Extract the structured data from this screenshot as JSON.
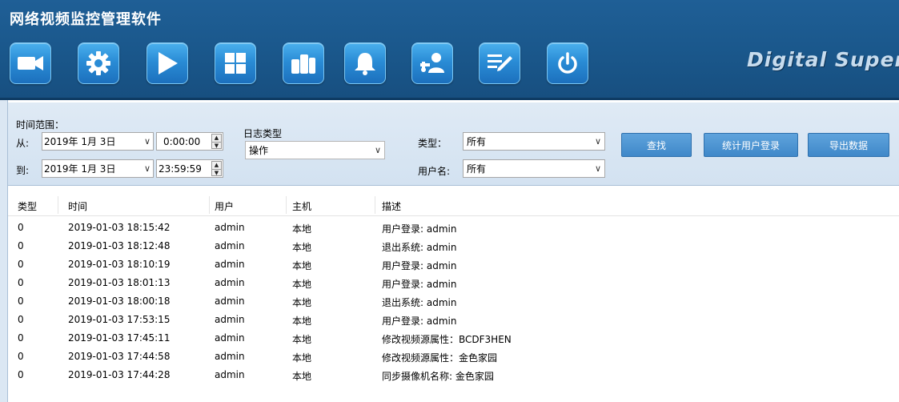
{
  "app": {
    "title": "网络视频监控管理软件",
    "brand": "Digital Supervi"
  },
  "toolbar": [
    {
      "icon": "video-camera-icon"
    },
    {
      "icon": "gear-icon"
    },
    {
      "icon": "play-icon"
    },
    {
      "icon": "grid-layout-icon"
    },
    {
      "icon": "device-icon"
    },
    {
      "icon": "alarm-bell-icon"
    },
    {
      "icon": "user-settings-icon"
    },
    {
      "icon": "log-edit-icon"
    },
    {
      "icon": "power-icon"
    }
  ],
  "filters": {
    "time_range_label": "时间范围：",
    "from_label": "从:",
    "to_label": "到:",
    "from_date": "2019年 1月 3日",
    "from_time": "0:00:00",
    "to_date": "2019年 1月 3日",
    "to_time": "23:59:59",
    "log_type_label": "日志类型",
    "log_type_value": "操作",
    "type_label": "类型：",
    "type_value": "所有",
    "username_label": "用户名:",
    "username_value": "所有"
  },
  "buttons": {
    "search": "查找",
    "stats": "统计用户登录",
    "export": "导出数据"
  },
  "table": {
    "headers": [
      "类型",
      "时间",
      "用户",
      "主机",
      "描述"
    ],
    "rows": [
      [
        "0",
        "2019-01-03 18:15:42",
        "admin",
        "本地",
        "用户登录: admin"
      ],
      [
        "0",
        "2019-01-03 18:12:48",
        "admin",
        "本地",
        "退出系统: admin"
      ],
      [
        "0",
        "2019-01-03 18:10:19",
        "admin",
        "本地",
        "用户登录: admin"
      ],
      [
        "0",
        "2019-01-03 18:01:13",
        "admin",
        "本地",
        "用户登录: admin"
      ],
      [
        "0",
        "2019-01-03 18:00:18",
        "admin",
        "本地",
        "退出系统: admin"
      ],
      [
        "0",
        "2019-01-03 17:53:15",
        "admin",
        "本地",
        "用户登录: admin"
      ],
      [
        "0",
        "2019-01-03 17:45:11",
        "admin",
        "本地",
        "修改视频源属性：BCDF3HEN"
      ],
      [
        "0",
        "2019-01-03 17:44:58",
        "admin",
        "本地",
        "修改视频源属性：金色家园"
      ],
      [
        "0",
        "2019-01-03 17:44:28",
        "admin",
        "本地",
        "同步摄像机名称: 金色家园"
      ]
    ]
  },
  "colors": {
    "header_bg": "#1a578b",
    "button_blue": "#2a8cd6",
    "panel_bg": "#d9e6f3"
  }
}
